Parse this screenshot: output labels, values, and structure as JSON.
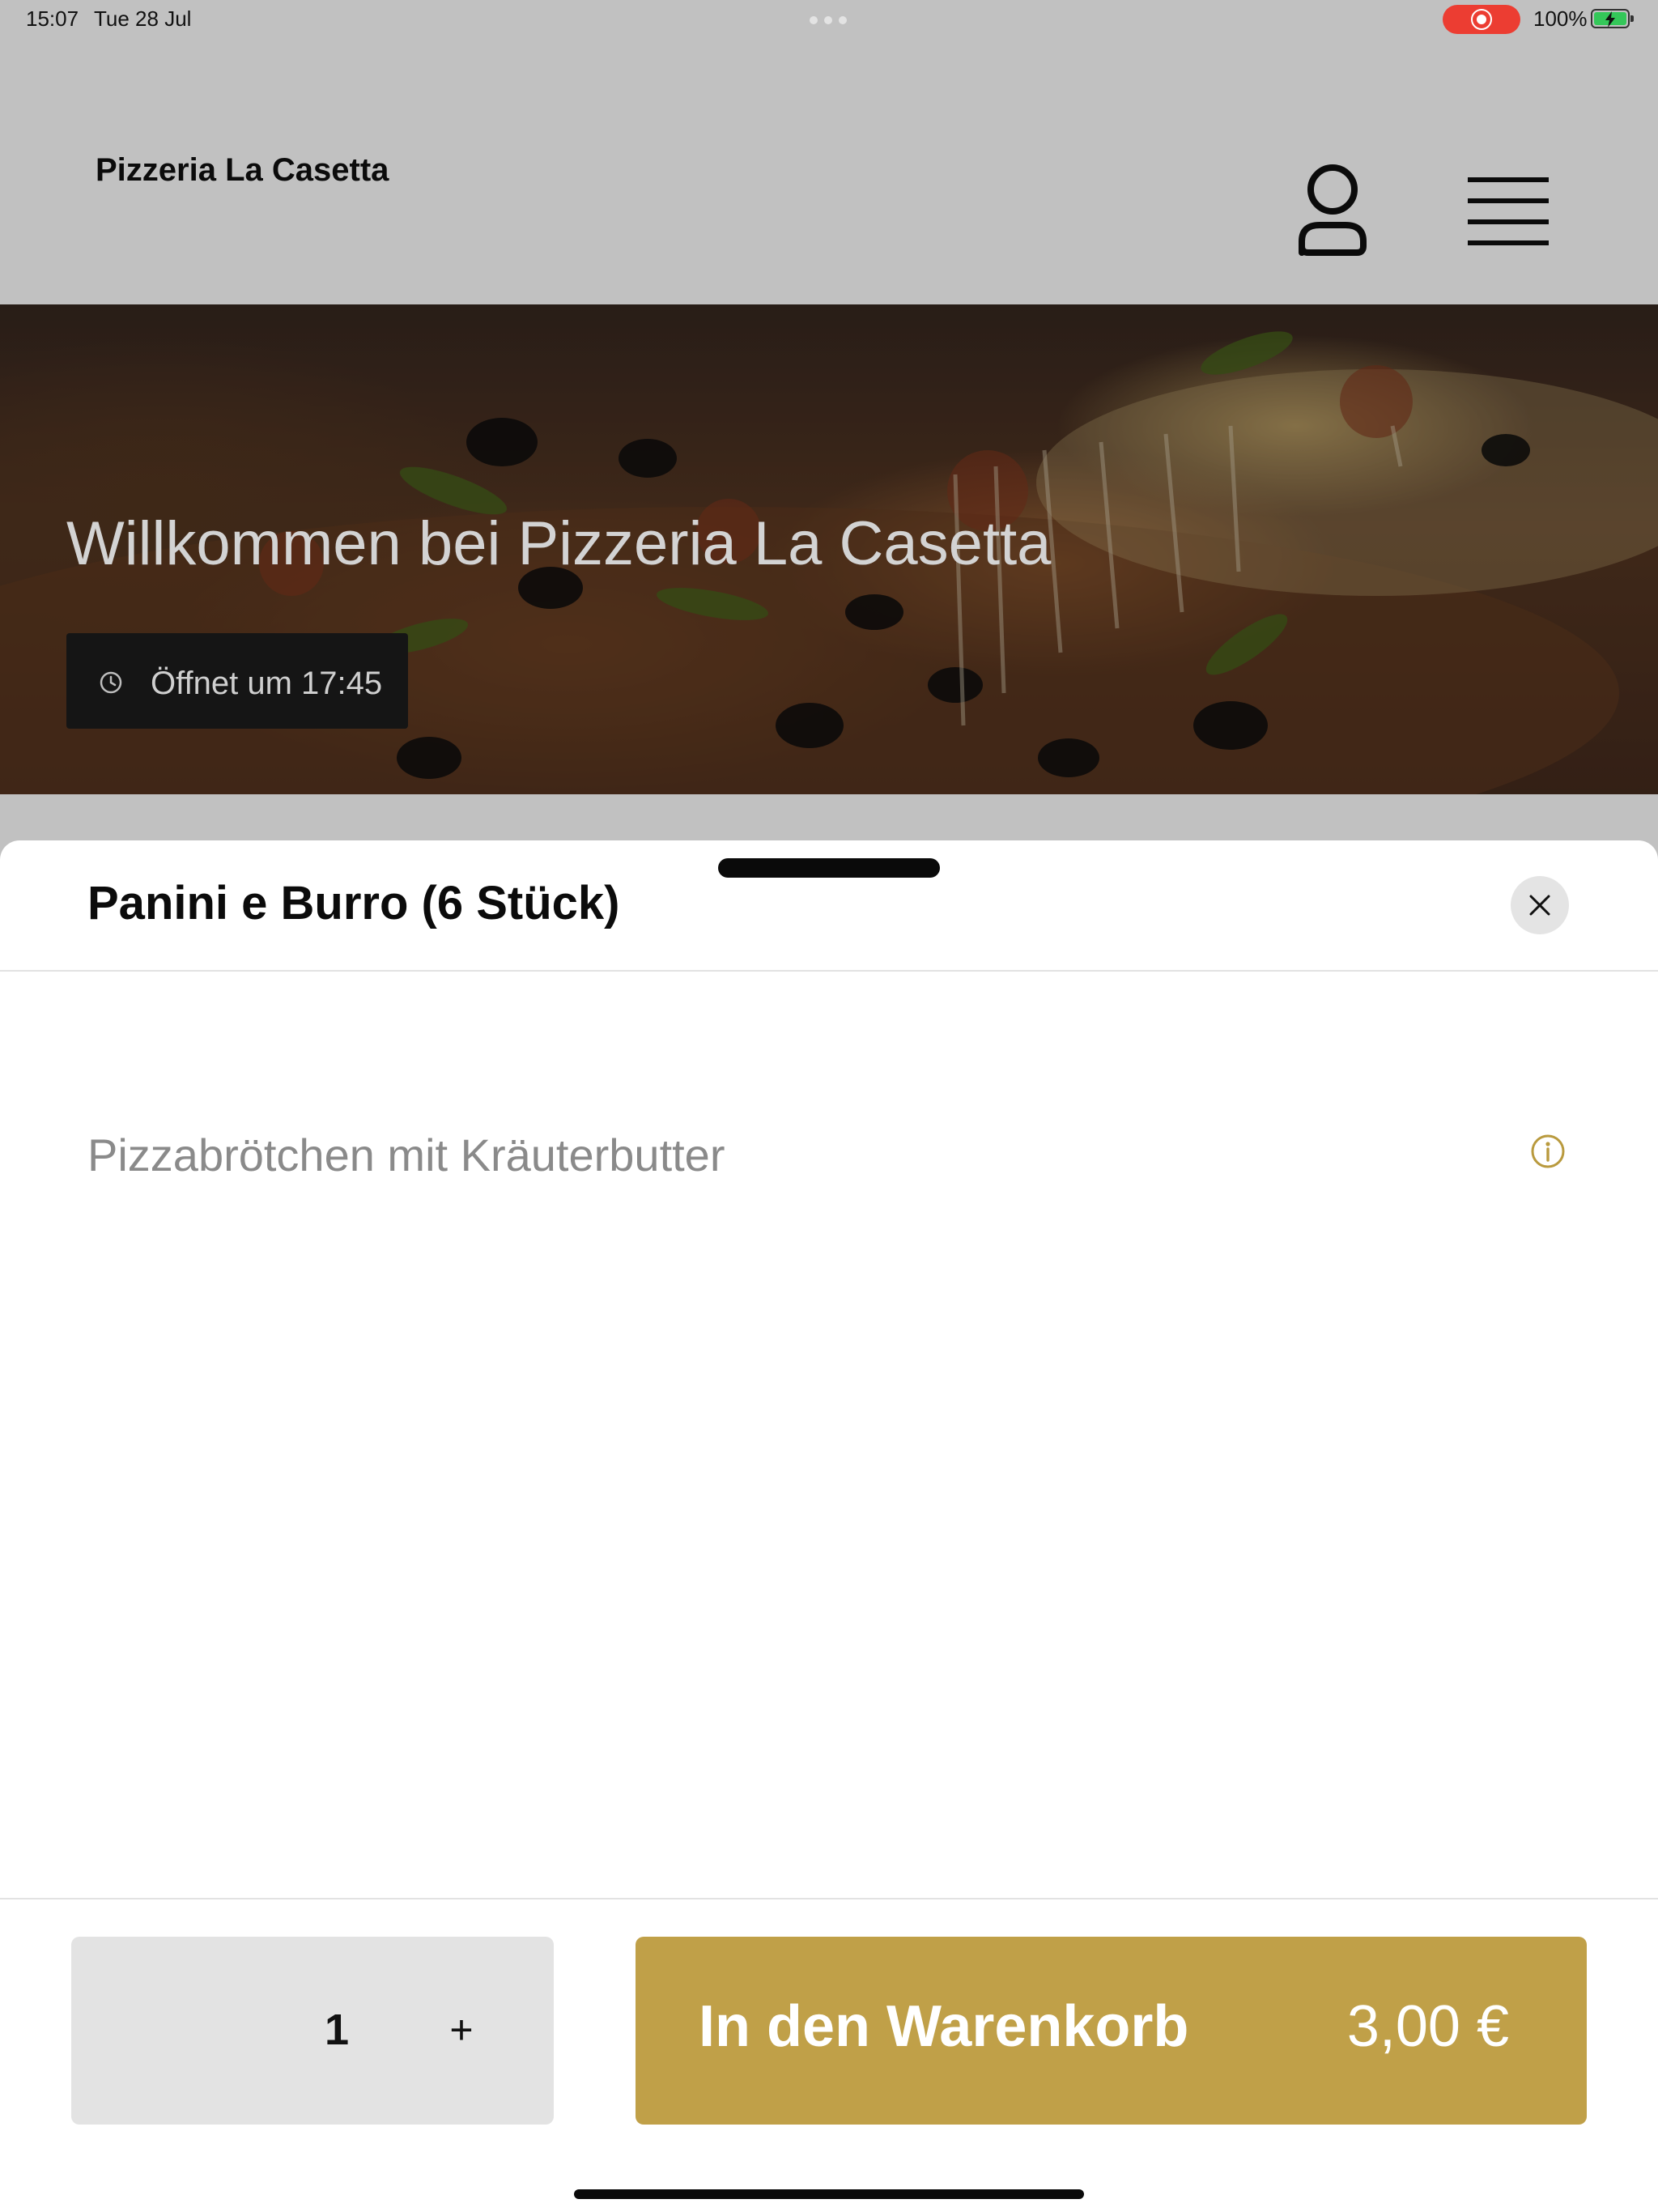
{
  "status_bar": {
    "time": "15:07",
    "date": "Tue 28 Jul",
    "battery_percent": "100%",
    "recording_icon": "screen-record-icon",
    "battery_icon": "battery-charging-icon"
  },
  "header": {
    "brand": "Pizzeria La Casetta",
    "user_icon": "user-icon",
    "menu_icon": "hamburger-menu-icon"
  },
  "hero": {
    "title": "Willkommen bei Pizzeria La Casetta",
    "opening_text": "Öffnet um 17:45",
    "opening_icon": "clock-icon"
  },
  "sheet": {
    "title": "Panini e Burro (6 Stück)",
    "close_icon": "close-icon",
    "description": "Pizzabrötchen mit Kräuterbutter",
    "info_icon": "info-icon",
    "quantity": "1",
    "quantity_increase": "+",
    "cart_label": "In den Warenkorb",
    "price": "3,00 €"
  },
  "colors": {
    "background": "#c1c1c1",
    "accent": "#c0a048",
    "info_icon": "#b99a3e",
    "quantity_box": "#e3e3e3",
    "record_pill": "#ec3d32",
    "battery_fill": "#34c759"
  }
}
